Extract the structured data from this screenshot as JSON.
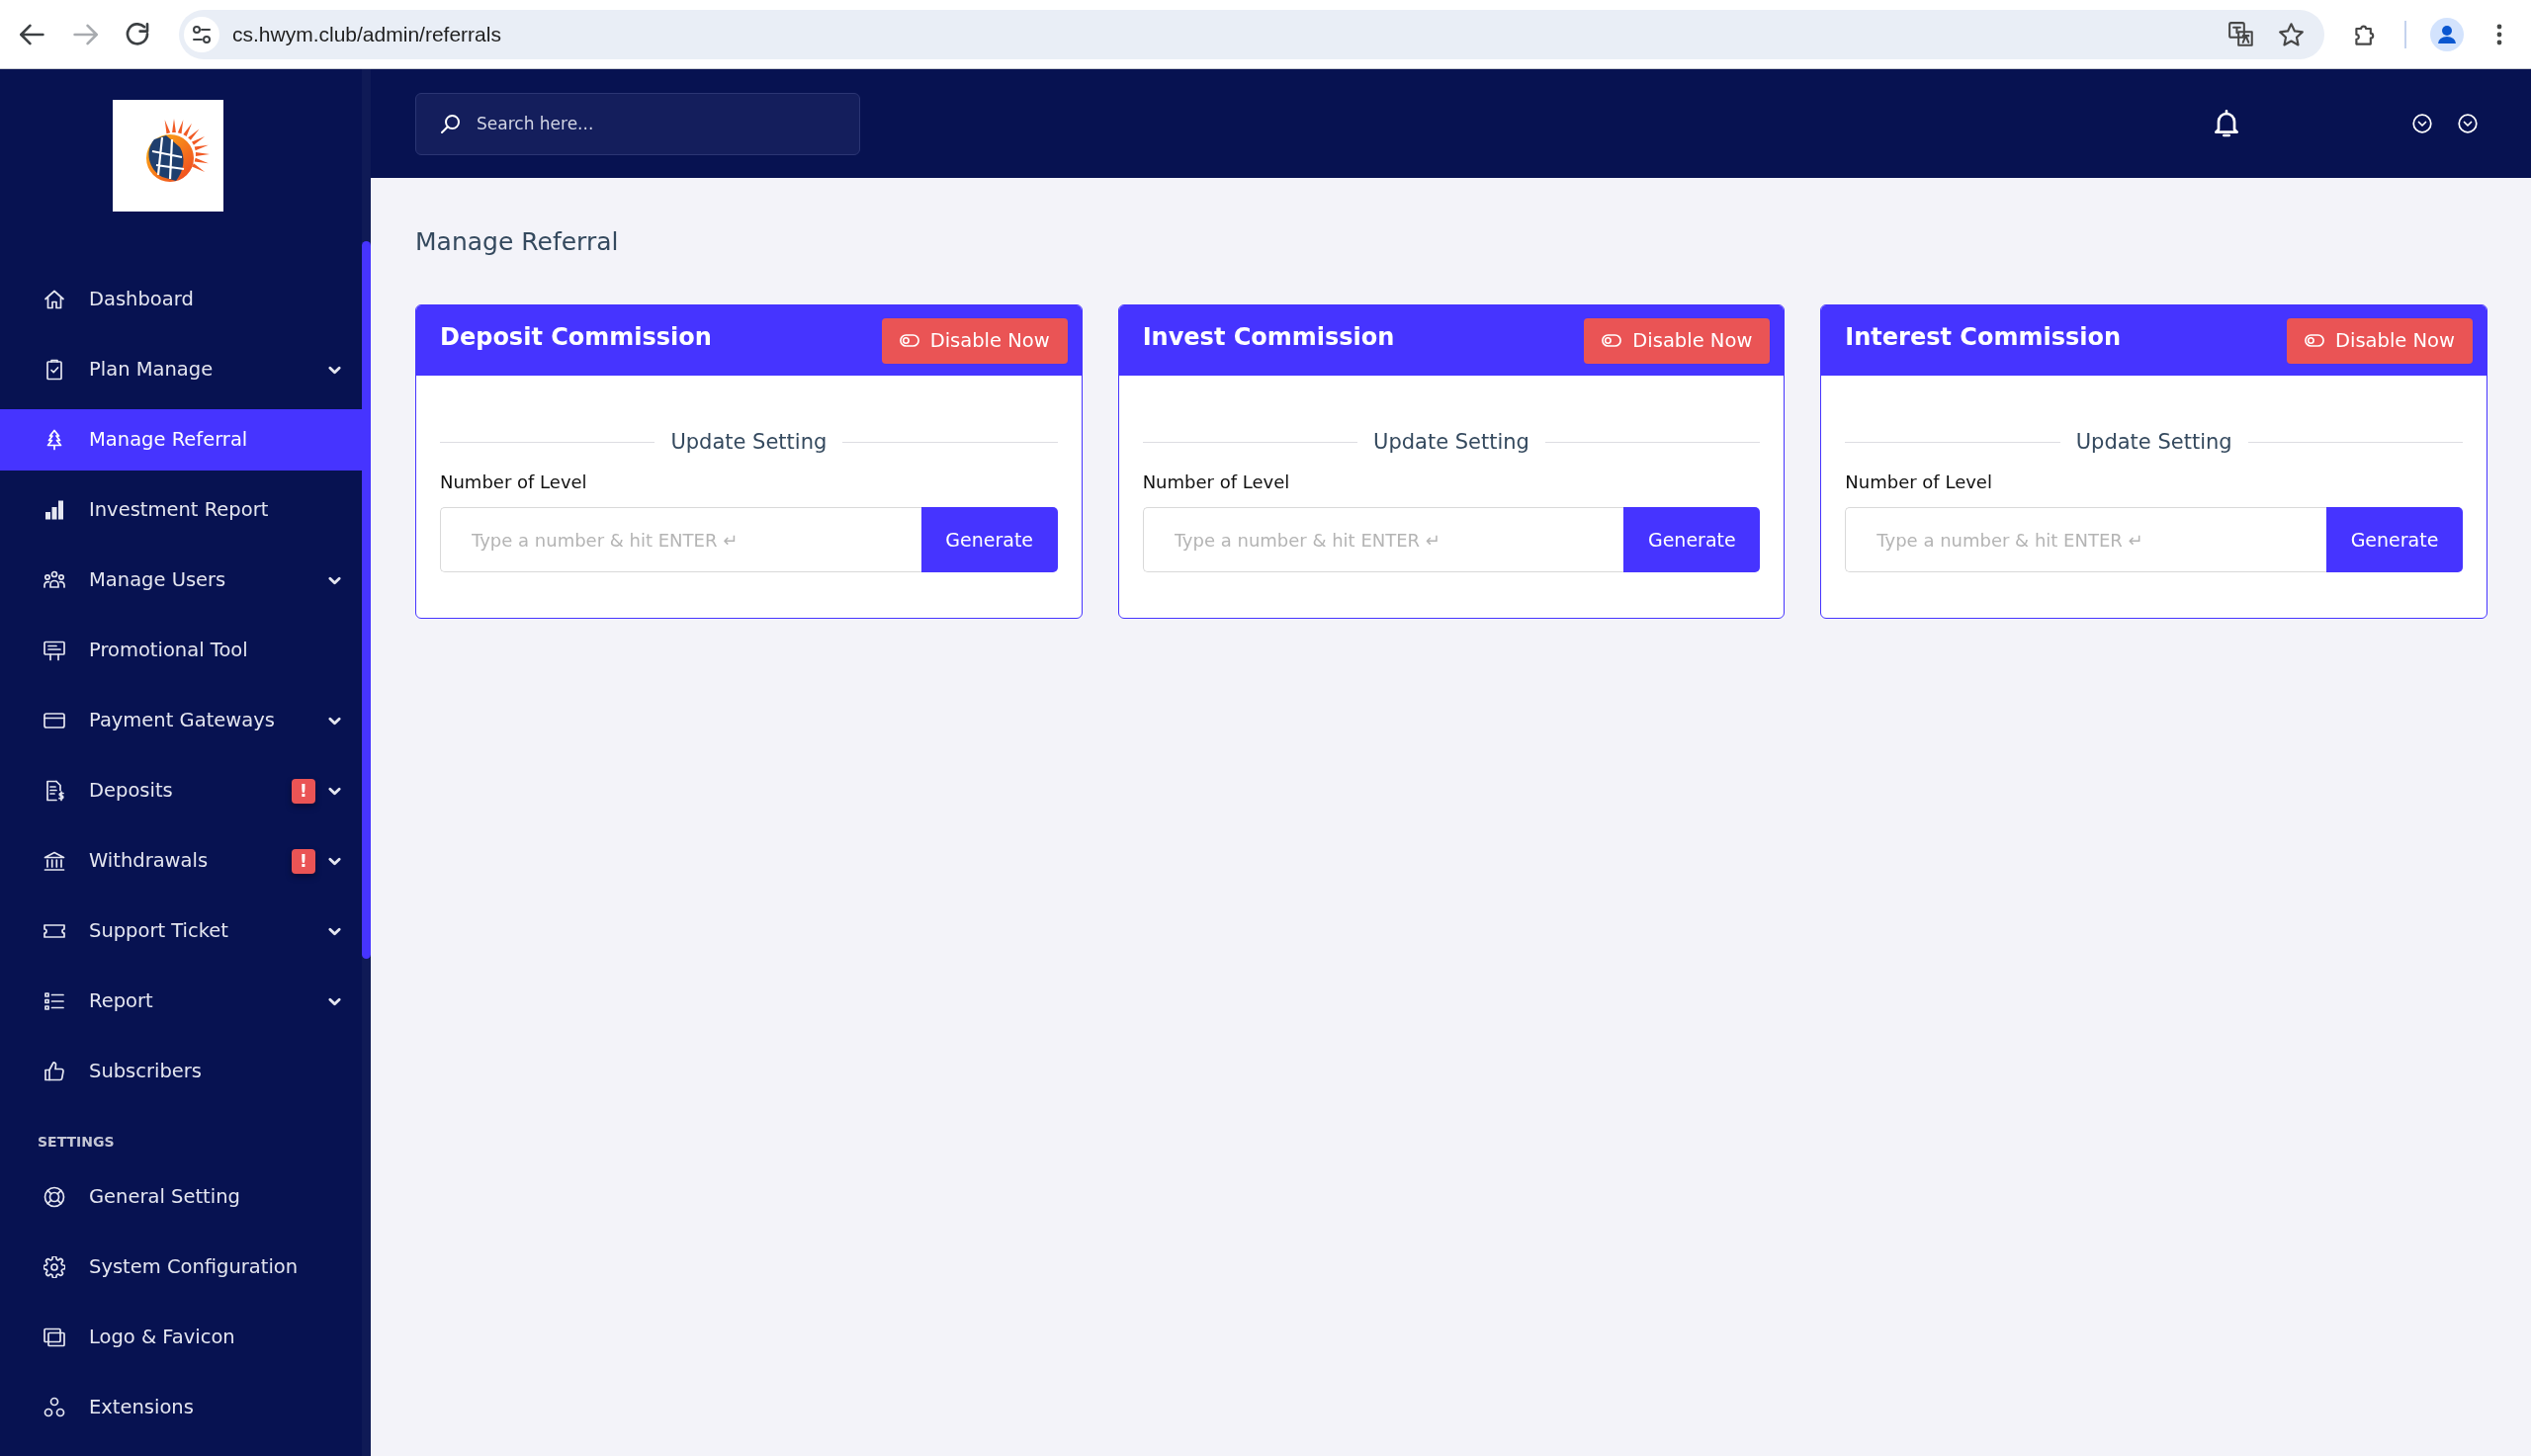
{
  "browser": {
    "url": "cs.hwym.club/admin/referrals",
    "can_go_forward": false
  },
  "sidebar": {
    "sections": [
      {
        "items": [
          {
            "label": "Dashboard",
            "kind": "link",
            "selected": false
          },
          {
            "label": "Plan Manage",
            "kind": "submenu",
            "selected": false
          },
          {
            "label": "Manage Referral",
            "kind": "link",
            "selected": true
          },
          {
            "label": "Investment Report",
            "kind": "link",
            "selected": false
          },
          {
            "label": "Manage Users",
            "kind": "submenu",
            "selected": false
          },
          {
            "label": "Promotional Tool",
            "kind": "link",
            "selected": false
          },
          {
            "label": "Payment Gateways",
            "kind": "submenu",
            "selected": false
          },
          {
            "label": "Deposits",
            "kind": "submenu",
            "selected": false,
            "badge": "!"
          },
          {
            "label": "Withdrawals",
            "kind": "submenu",
            "selected": false,
            "badge": "!"
          },
          {
            "label": "Support Ticket",
            "kind": "submenu",
            "selected": false
          },
          {
            "label": "Report",
            "kind": "submenu",
            "selected": false
          },
          {
            "label": "Subscribers",
            "kind": "link",
            "selected": false
          }
        ]
      },
      {
        "title": "SETTINGS",
        "items": [
          {
            "label": "General Setting",
            "kind": "link",
            "selected": false
          },
          {
            "label": "System Configuration",
            "kind": "link",
            "selected": false
          },
          {
            "label": "Logo & Favicon",
            "kind": "link",
            "selected": false
          },
          {
            "label": "Extensions",
            "kind": "link",
            "selected": false
          }
        ]
      }
    ]
  },
  "header": {
    "search": {
      "placeholder": "Search here..."
    }
  },
  "page": {
    "title": "Manage Referral"
  },
  "cards": [
    {
      "title": "Deposit Commission",
      "toggle_button": "Disable Now",
      "setting_heading": "Update Setting",
      "field_label": "Number of Level",
      "field": {
        "placeholder": "Type a number & hit ENTER ↵"
      },
      "action_button": "Generate"
    },
    {
      "title": "Invest Commission",
      "toggle_button": "Disable Now",
      "setting_heading": "Update Setting",
      "field_label": "Number of Level",
      "field": {
        "placeholder": "Type a number & hit ENTER ↵"
      },
      "action_button": "Generate"
    },
    {
      "title": "Interest Commission",
      "toggle_button": "Disable Now",
      "setting_heading": "Update Setting",
      "field_label": "Number of Level",
      "field": {
        "placeholder": "Type a number & hit ENTER ↵"
      },
      "action_button": "Generate"
    }
  ]
}
